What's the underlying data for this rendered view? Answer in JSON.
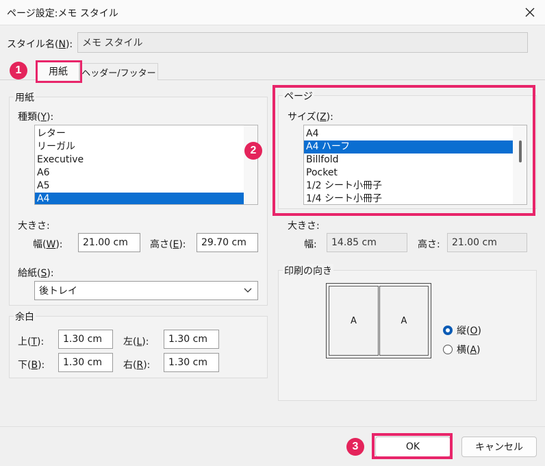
{
  "window": {
    "title": "ページ設定:メモ スタイル"
  },
  "style_name": {
    "label_pre": "スタイル名(",
    "key": "N",
    "label_post": "):",
    "value": "メモ スタイル"
  },
  "tabs": [
    {
      "label": "用紙"
    },
    {
      "label": "ヘッダー/フッター"
    }
  ],
  "paper": {
    "group_title": "用紙",
    "type_label_pre": "種類(",
    "type_key": "Y",
    "type_label_post": "):",
    "types": [
      "レター",
      "リーガル",
      "Executive",
      "A6",
      "A5",
      "A4"
    ],
    "selected_type": "A4",
    "size_label": "大きさ:",
    "width_label_pre": "幅(",
    "width_key": "W",
    "width_label_post": "):",
    "width_value": "21.00 cm",
    "height_label_pre": "高さ(",
    "height_key": "E",
    "height_label_post": "):",
    "height_value": "29.70 cm",
    "feed_label_pre": "給紙(",
    "feed_key": "S",
    "feed_label_post": "):",
    "feed_value": "後トレイ"
  },
  "margins": {
    "group_title": "余白",
    "top": {
      "pre": "上(",
      "key": "T",
      "post": "):",
      "value": "1.30 cm"
    },
    "left": {
      "pre": "左(",
      "key": "L",
      "post": "):",
      "value": "1.30 cm"
    },
    "bottom": {
      "pre": "下(",
      "key": "B",
      "post": "):",
      "value": "1.30 cm"
    },
    "right": {
      "pre": "右(",
      "key": "R",
      "post": "):",
      "value": "1.30 cm"
    }
  },
  "page": {
    "group_title": "ページ",
    "size_label_pre": "サイズ(",
    "size_key": "Z",
    "size_label_post": "):",
    "sizes": [
      "A4",
      "A4 ハーフ",
      "Billfold",
      "Pocket",
      "1/2 シート小冊子",
      "1/4 シート小冊子"
    ],
    "selected_size": "A4 ハーフ",
    "dims_label": "大きさ:",
    "width_label": "幅:",
    "width_value": "14.85 cm",
    "height_label": "高さ:",
    "height_value": "21.00 cm"
  },
  "orientation": {
    "group_title": "印刷の向き",
    "preview_letter": "A",
    "portrait": {
      "pre": "縦(",
      "key": "O",
      "post": ")",
      "selected": true
    },
    "landscape": {
      "pre": "横(",
      "key": "A",
      "post": ")",
      "selected": false
    }
  },
  "callouts": [
    "1",
    "2",
    "3"
  ],
  "buttons": {
    "ok": "OK",
    "cancel": "キャンセル"
  },
  "colors": {
    "highlight": "#e8256a",
    "selection": "#0a6ed1",
    "callout": "#e4245b"
  }
}
